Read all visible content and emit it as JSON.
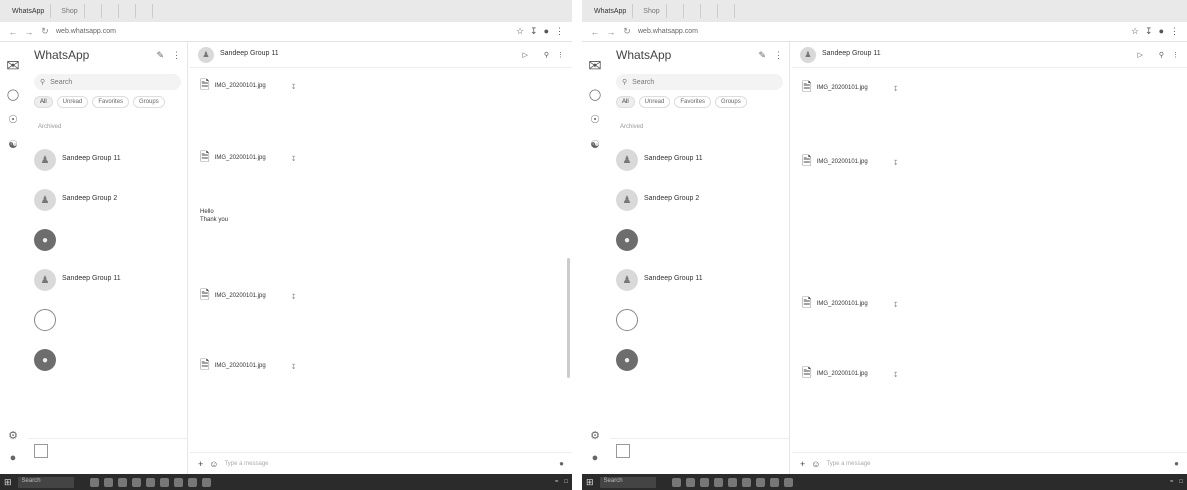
{
  "left": {
    "tabs": [
      "WhatsApp",
      "Shop",
      "",
      "",
      "",
      "",
      "",
      ""
    ],
    "url": "web.whatsapp.com",
    "app_title": "WhatsApp",
    "search_placeholder": "Search",
    "filters": [
      "All",
      "Unread",
      "Favorites",
      "Groups"
    ],
    "archived_label": "Archived",
    "chats": [
      {
        "name": "Sandeep Group 11",
        "preview": "",
        "time": ""
      },
      {
        "name": "Sandeep Group 2",
        "preview": "",
        "time": ""
      },
      {
        "name": "",
        "preview": "",
        "time": ""
      },
      {
        "name": "Sandeep Group 11",
        "preview": "",
        "time": ""
      },
      {
        "name": "",
        "preview": "",
        "time": ""
      },
      {
        "name": "",
        "preview": "",
        "time": ""
      }
    ],
    "notice_text": "",
    "conversation": {
      "name": "Sandeep Group 11",
      "subtitle": "",
      "right_label": "",
      "files": [
        {
          "name": "IMG_20200101.jpg",
          "size": "",
          "top": 0
        },
        {
          "name": "IMG_20200101.jpg",
          "size": ""
        },
        {
          "name": "IMG_20200101.jpg",
          "size": ""
        },
        {
          "name": "IMG_20200101.jpg",
          "size": ""
        }
      ],
      "text_message": "Hello\nThank you\n\n",
      "composer_placeholder": "Type a message"
    },
    "taskbar": {
      "search": "Search",
      "tray": ""
    }
  },
  "right": {
    "tabs": [
      "WhatsApp",
      "Shop",
      "",
      "",
      "",
      "",
      "",
      ""
    ],
    "url": "web.whatsapp.com",
    "app_title": "WhatsApp",
    "search_placeholder": "Search",
    "filters": [
      "All",
      "Unread",
      "Favorites",
      "Groups"
    ],
    "archived_label": "Archived",
    "chats": [
      {
        "name": "Sandeep Group 11",
        "preview": "",
        "time": ""
      },
      {
        "name": "Sandeep Group 2",
        "preview": "",
        "time": ""
      },
      {
        "name": "",
        "preview": "",
        "time": ""
      },
      {
        "name": "Sandeep Group 11",
        "preview": "",
        "time": ""
      },
      {
        "name": "",
        "preview": "",
        "time": ""
      },
      {
        "name": "",
        "preview": "",
        "time": ""
      }
    ],
    "notice_text": "",
    "conversation": {
      "name": "Sandeep Group 11",
      "subtitle": "",
      "right_label": "",
      "files": [
        {
          "name": "IMG_20200101.jpg",
          "size": ""
        },
        {
          "name": "IMG_20200101.jpg",
          "size": ""
        },
        {
          "name": "IMG_20200101.jpg",
          "size": ""
        },
        {
          "name": "IMG_20200101.jpg",
          "size": ""
        }
      ],
      "text_message": "",
      "composer_placeholder": "Type a message"
    },
    "taskbar": {
      "search": "Search",
      "tray": ""
    }
  }
}
